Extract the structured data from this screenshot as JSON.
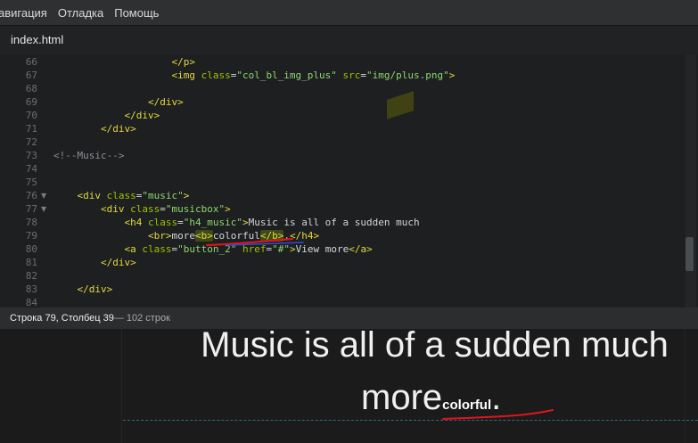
{
  "menu": {
    "items": [
      "авигация",
      "Отладка",
      "Помощь"
    ]
  },
  "tab": {
    "filename": "index.html"
  },
  "editor": {
    "lines": [
      {
        "num": "66",
        "fold": false,
        "segments": [
          [
            "",
            "                    "
          ],
          [
            "t",
            "</p>"
          ]
        ]
      },
      {
        "num": "67",
        "fold": false,
        "segments": [
          [
            "",
            "                    "
          ],
          [
            "t",
            "<img"
          ],
          [
            "",
            " "
          ],
          [
            "a",
            "class"
          ],
          [
            "",
            "="
          ],
          [
            "s",
            "\"col_bl_img_plus\""
          ],
          [
            "",
            " "
          ],
          [
            "a",
            "src"
          ],
          [
            "",
            "="
          ],
          [
            "s",
            "\"img/plus.png\""
          ],
          [
            "t",
            ">"
          ]
        ]
      },
      {
        "num": "68",
        "fold": false,
        "segments": [
          [
            "",
            ""
          ]
        ]
      },
      {
        "num": "69",
        "fold": false,
        "segments": [
          [
            "",
            "                "
          ],
          [
            "t",
            "</div>"
          ]
        ]
      },
      {
        "num": "70",
        "fold": false,
        "segments": [
          [
            "",
            "            "
          ],
          [
            "t",
            "</div>"
          ]
        ]
      },
      {
        "num": "71",
        "fold": false,
        "segments": [
          [
            "",
            "        "
          ],
          [
            "t",
            "</div>"
          ]
        ]
      },
      {
        "num": "72",
        "fold": false,
        "segments": [
          [
            "",
            ""
          ]
        ]
      },
      {
        "num": "73",
        "fold": false,
        "segments": [
          [
            "c",
            "<!--Music-->"
          ]
        ]
      },
      {
        "num": "74",
        "fold": false,
        "segments": [
          [
            "",
            ""
          ]
        ]
      },
      {
        "num": "75",
        "fold": false,
        "segments": [
          [
            "",
            ""
          ]
        ]
      },
      {
        "num": "76",
        "fold": true,
        "segments": [
          [
            "",
            "    "
          ],
          [
            "t",
            "<div"
          ],
          [
            "",
            " "
          ],
          [
            "a",
            "class"
          ],
          [
            "",
            "="
          ],
          [
            "s",
            "\"music\""
          ],
          [
            "t",
            ">"
          ]
        ]
      },
      {
        "num": "77",
        "fold": true,
        "segments": [
          [
            "",
            "        "
          ],
          [
            "t",
            "<div"
          ],
          [
            "",
            " "
          ],
          [
            "a",
            "class"
          ],
          [
            "",
            "="
          ],
          [
            "s",
            "\"musicbox\""
          ],
          [
            "t",
            ">"
          ]
        ]
      },
      {
        "num": "78",
        "fold": false,
        "segments": [
          [
            "",
            "            "
          ],
          [
            "t",
            "<h4"
          ],
          [
            "",
            " "
          ],
          [
            "a",
            "class"
          ],
          [
            "",
            "="
          ],
          [
            "s",
            "\"h4_music\""
          ],
          [
            "t",
            ">"
          ],
          [
            "",
            "Music is all of a sudden much"
          ]
        ]
      },
      {
        "num": "79",
        "fold": false,
        "segments": [
          [
            "",
            "                "
          ],
          [
            "t",
            "<br>"
          ],
          [
            "",
            "more"
          ],
          [
            "th",
            "<b>"
          ],
          [
            "",
            "colorful"
          ],
          [
            "th",
            "</b>"
          ],
          [
            "",
            "."
          ],
          [
            "t",
            "</h4>"
          ]
        ]
      },
      {
        "num": "80",
        "fold": false,
        "segments": [
          [
            "",
            "            "
          ],
          [
            "t",
            "<a"
          ],
          [
            "",
            " "
          ],
          [
            "a",
            "class"
          ],
          [
            "",
            "="
          ],
          [
            "s",
            "\"button_2\""
          ],
          [
            "",
            " "
          ],
          [
            "a",
            "href"
          ],
          [
            "",
            "="
          ],
          [
            "s",
            "\"#\""
          ],
          [
            "t",
            ">"
          ],
          [
            "",
            "View more"
          ],
          [
            "t",
            "</a>"
          ]
        ]
      },
      {
        "num": "81",
        "fold": false,
        "segments": [
          [
            "",
            "        "
          ],
          [
            "t",
            "</div>"
          ]
        ]
      },
      {
        "num": "82",
        "fold": false,
        "segments": [
          [
            "",
            ""
          ]
        ]
      },
      {
        "num": "83",
        "fold": false,
        "segments": [
          [
            "",
            "    "
          ],
          [
            "t",
            "</div>"
          ]
        ]
      },
      {
        "num": "84",
        "fold": false,
        "segments": [
          [
            "",
            ""
          ]
        ]
      }
    ]
  },
  "status": {
    "position": "Строка 79, Столбец 39",
    "lines_count": " — 102 строк"
  },
  "preview": {
    "heading": "Music is all of a sudden much",
    "more_text": "more",
    "bold_text": "colorful",
    "period": "."
  },
  "colors": {
    "tag": "#e4d83d",
    "attribute": "#9ec400",
    "string": "#8ed66f",
    "comment": "#8a8f94",
    "annotation_red": "#e0141c",
    "annotation_blue": "#2a4fd6"
  }
}
